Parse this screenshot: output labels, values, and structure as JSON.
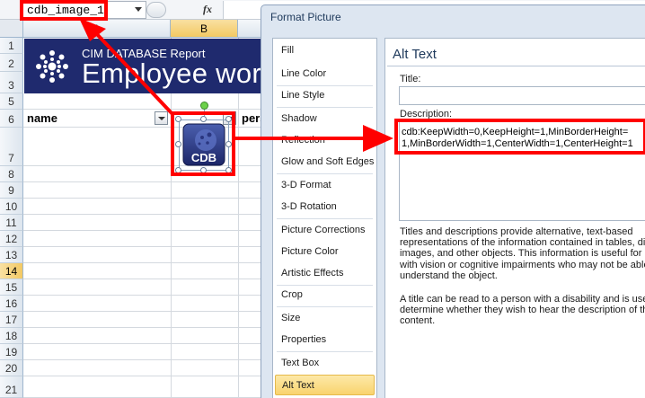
{
  "formula_bar": {
    "name_box_value": "cdb_image_1",
    "fx_label": "fx"
  },
  "sheet": {
    "columns": [
      "A",
      "B"
    ],
    "selected_column": "B",
    "partial_column_label": "pers",
    "rows": [
      "1",
      "2",
      "3",
      "5",
      "6",
      "7",
      "8",
      "9",
      "10",
      "11",
      "12",
      "13",
      "14",
      "15",
      "16",
      "17",
      "18",
      "19",
      "20",
      "21"
    ],
    "selected_row": "14",
    "banner": {
      "subtitle": "CIM DATABASE Report",
      "title": "Employee work"
    },
    "header_cells": {
      "name": "name"
    },
    "image_label": "CDB"
  },
  "dialog": {
    "title": "Format Picture",
    "nav_items": [
      "Fill",
      "Line Color",
      "Line Style",
      "Shadow",
      "Reflection",
      "Glow and Soft Edges",
      "3-D Format",
      "3-D Rotation",
      "Picture Corrections",
      "Picture Color",
      "Artistic Effects",
      "Crop",
      "Size",
      "Properties",
      "Text Box",
      "Alt Text"
    ],
    "active_item": "Alt Text",
    "panel_heading": "Alt Text",
    "title_label": "Title:",
    "title_value": "",
    "description_label": "Description:",
    "description_value": "cdb:KeepWidth=0,KeepHeight=1,MinBorderHeight=\n1,MinBorderWidth=1,CenterWidth=1,CenterHeight=1",
    "help_paragraph_1": "Titles and descriptions provide alternative, text-based\nrepresentations of the information contained in tables, di\nimages, and other objects. This information is useful for p\nwith vision or cognitive impairments who may not be able\nunderstand the object.",
    "help_paragraph_2": "A title can be read to a person with a disability and is use\ndetermine whether they wish to hear the description of th\ncontent."
  },
  "annotation_color": "#ff0000"
}
